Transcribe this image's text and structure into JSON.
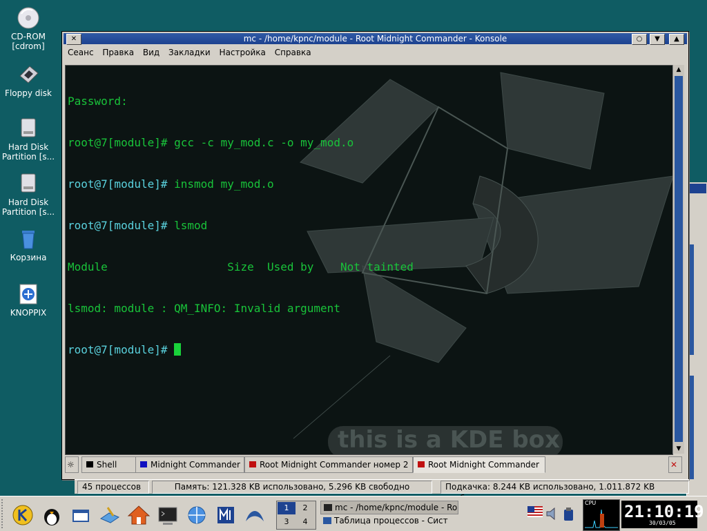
{
  "desktop": {
    "icons": [
      {
        "label": "CD-ROM\n[cdrom]",
        "icon": "cdrom-icon"
      },
      {
        "label": "Floppy disk",
        "icon": "floppy-icon"
      },
      {
        "label": "Hard Disk\nPartition [s...",
        "icon": "harddisk-icon"
      },
      {
        "label": "Hard Disk\nPartition [s...",
        "icon": "harddisk-icon"
      },
      {
        "label": "Корзина",
        "icon": "trash-icon"
      },
      {
        "label": "KNOPPIX",
        "icon": "knoppix-icon"
      }
    ]
  },
  "window": {
    "title": "mc - /home/kpnc/module - Root Midnight Commander - Konsole",
    "menu": [
      "Сеанс",
      "Правка",
      "Вид",
      "Закладки",
      "Настройка",
      "Справка"
    ],
    "terminal": {
      "lines": [
        {
          "prompt": "",
          "text": "Password:"
        },
        {
          "prompt": "root@7[module]#",
          "text": " gcc -c my_mod.c -o my_mod.o"
        },
        {
          "prompt": "root@7[module]#",
          "text": " insmod my_mod.o"
        },
        {
          "prompt": "root@7[module]#",
          "text": " lsmod"
        },
        {
          "prompt": "",
          "text": "Module                  Size  Used by    Not tainted"
        },
        {
          "prompt": "",
          "text": "lsmod: module : QM_INFO: Invalid argument"
        },
        {
          "prompt": "root@7[module]#",
          "text": " "
        }
      ],
      "watermark": "this is a KDE box"
    },
    "tabs": [
      {
        "label": "Shell",
        "color": "#000000"
      },
      {
        "label": "Midnight Commander",
        "color": "#1010c0"
      },
      {
        "label": "Root Midnight Commander номер 2",
        "color": "#c01010"
      },
      {
        "label": "Root Midnight Commander",
        "color": "#c01010"
      }
    ]
  },
  "statusbar": {
    "processes": "45 процессов",
    "memory": "Память: 121.328 KB использовано, 5.296 KB свободно",
    "swap": "Подкачка: 8.244 KB использовано, 1.011.872 KB свободно"
  },
  "taskbar": {
    "pager": [
      "1",
      "2",
      "3",
      "4"
    ],
    "tasks": [
      "mc - /home/kpnc/module - Ro",
      "Таблица процессов - Сист"
    ],
    "cpu_label": "CPU",
    "clock": "21:10:19",
    "date": "30/03/05"
  },
  "colors": {
    "desktop": "#0f5c63",
    "titlebar": "#1d4290",
    "prompt": "#5ad2de",
    "output": "#19c43a"
  }
}
